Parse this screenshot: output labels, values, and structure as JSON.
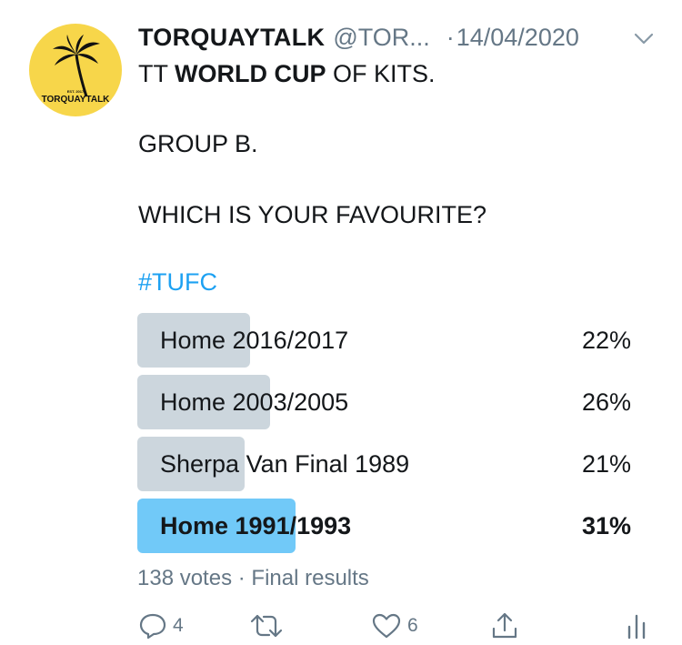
{
  "tweet": {
    "display_name": "TORQUAYTALK",
    "handle": "@TOR...",
    "separator": "·",
    "date": "14/04/2020",
    "avatar": {
      "brand_text": "TORQUAYTALK",
      "est_text": "EST. 2017",
      "background": "#f7d64a",
      "icon": "palm-tree-icon"
    },
    "text": {
      "line1_prefix": "TT ",
      "line1_bold": "WORLD CUP",
      "line1_suffix": " OF KITS.",
      "line2": "GROUP B.",
      "line3": "WHICH IS YOUR FAVOURITE?"
    },
    "hashtag": "#TUFC"
  },
  "poll": {
    "options": [
      {
        "label": "Home 2016/2017",
        "percent_text": "22%",
        "percent": 22,
        "winner": false
      },
      {
        "label": "Home 2003/2005",
        "percent_text": "26%",
        "percent": 26,
        "winner": false
      },
      {
        "label": "Sherpa Van Final 1989",
        "percent_text": "21%",
        "percent": 21,
        "winner": false
      },
      {
        "label": "Home 1991/1993",
        "percent_text": "31%",
        "percent": 31,
        "winner": true
      }
    ],
    "votes": "138 votes",
    "separator": "·",
    "status": "Final results"
  },
  "actions": {
    "reply_count": "4",
    "like_count": "6"
  },
  "colors": {
    "accent": "#1da1f2",
    "winner_bar": "#71c9f8",
    "bar": "#ccd6dd",
    "muted": "#657786"
  }
}
